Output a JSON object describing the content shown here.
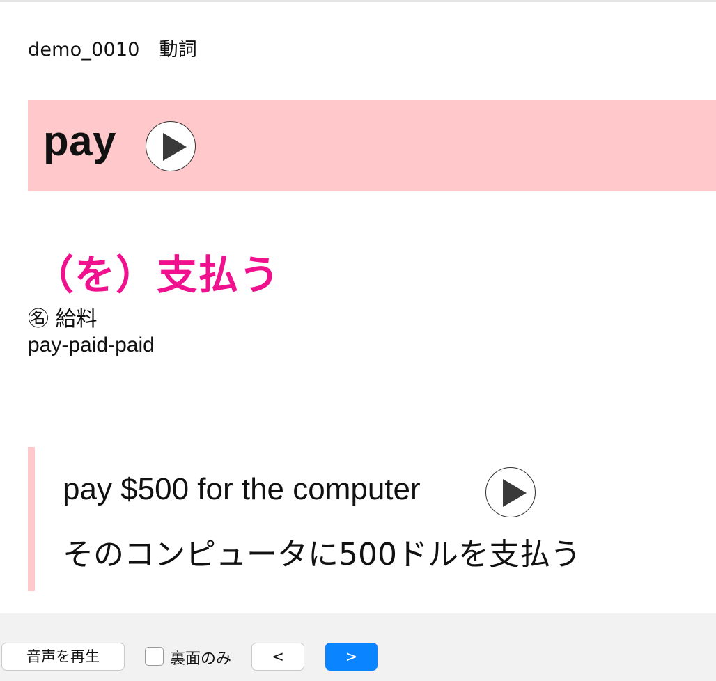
{
  "card": {
    "id": "demo_0010",
    "part_of_speech": "動詞",
    "word": "pay",
    "meaning": "（を）支払う",
    "noun": "㊔ 給料",
    "forms": "pay-paid-paid",
    "example_en": "pay $500 for the computer",
    "example_ja": "そのコンピュータに500ドルを支払う"
  },
  "controls": {
    "play_audio_label": "音声を再生",
    "back_only_label": "裏面のみ",
    "back_only_checked": false,
    "prev_label": "<",
    "next_label": ">"
  },
  "icons": {
    "word_play": "play-icon",
    "example_play": "play-icon"
  },
  "colors": {
    "word_band": "#ffc8ca",
    "meaning_text": "#f0118e",
    "example_bar": "#ffc8ca",
    "next_button": "#0a84ff",
    "footer_bg": "#f2f2f2"
  }
}
